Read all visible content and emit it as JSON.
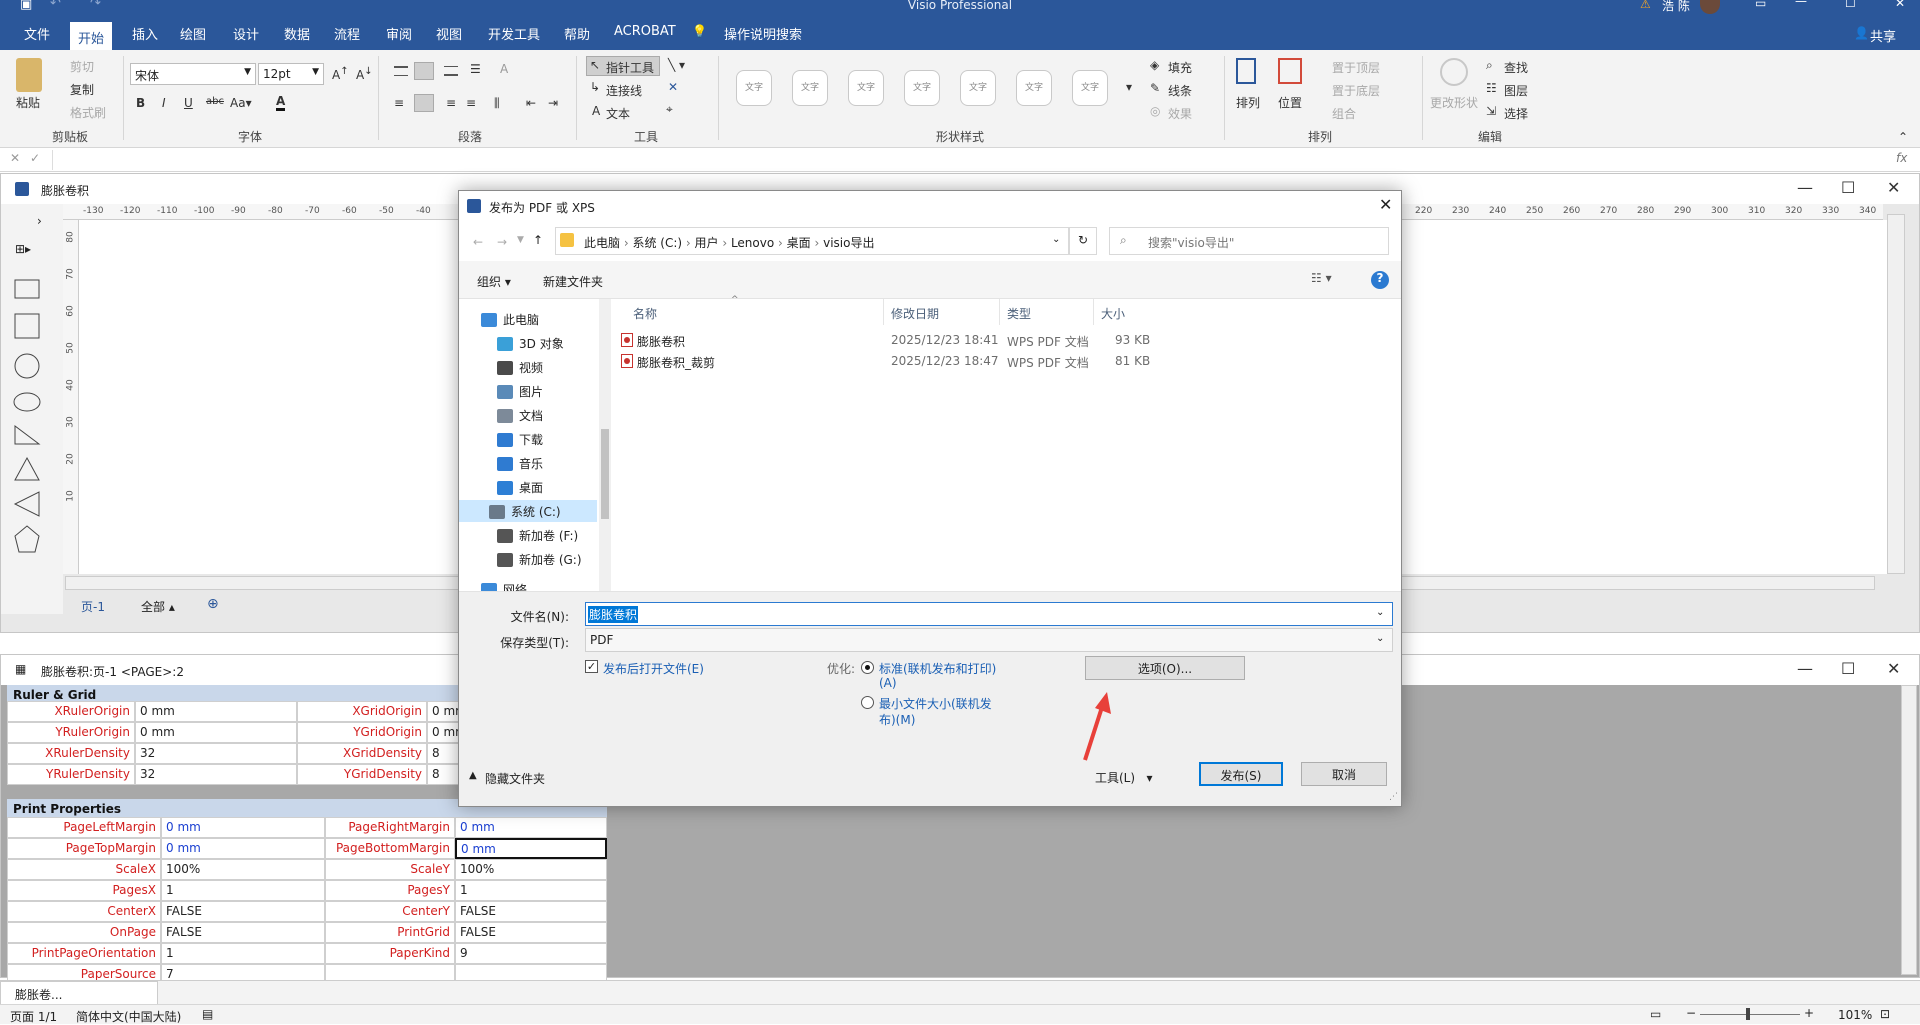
{
  "app": {
    "title": "Visio Professional",
    "user": "浩 陈",
    "share": "共享"
  },
  "menu": [
    "文件",
    "开始",
    "插入",
    "绘图",
    "设计",
    "数据",
    "流程",
    "审阅",
    "视图",
    "开发工具",
    "帮助",
    "ACROBAT",
    "操作说明搜索"
  ],
  "ribbon": {
    "clipboard": {
      "paste": "粘贴",
      "cut": "剪切",
      "copy": "复制",
      "format_painter": "格式刷",
      "label": "剪贴板"
    },
    "font": {
      "name": "宋体",
      "size": "12pt",
      "label": "字体"
    },
    "paragraph": {
      "label": "段落"
    },
    "tools": {
      "pointer": "指针工具",
      "connector": "连接线",
      "text": "文本",
      "label": "工具"
    },
    "shape_styles": {
      "preview_text": "文字",
      "fill": "填充",
      "line": "线条",
      "effects": "效果",
      "label": "形状样式"
    },
    "arrange": {
      "arrange": "排列",
      "position": "位置",
      "bring_front": "置于顶层",
      "send_back": "置于底层",
      "group": "组合",
      "label": "排列"
    },
    "editing": {
      "change_shape": "更改形状",
      "find": "查找",
      "layers": "图层",
      "select": "选择",
      "label": "编辑"
    }
  },
  "drawing_window": {
    "title": "膨胀卷积",
    "ruler_ticks_left": [
      "-130",
      "-120",
      "-110",
      "-100",
      "-90",
      "-80",
      "-70",
      "-60",
      "-50",
      "-40"
    ],
    "ruler_ticks_right": [
      "220",
      "230",
      "240",
      "250",
      "260",
      "270",
      "280",
      "290",
      "300",
      "310",
      "320",
      "330",
      "340"
    ],
    "vruler_ticks": [
      "80",
      "70",
      "60",
      "50",
      "40",
      "30",
      "20",
      "10"
    ],
    "page_tab": "页-1",
    "all_tab": "全部"
  },
  "shapesheet": {
    "title": "膨胀卷积:页-1 <PAGE>:2",
    "ruler_grid_title": "Ruler & Grid",
    "ruler_rows": [
      {
        "l1": "XRulerOrigin",
        "v1": "0 mm",
        "l2": "XGridOrigin",
        "v2": "0 mm"
      },
      {
        "l1": "YRulerOrigin",
        "v1": "0 mm",
        "l2": "YGridOrigin",
        "v2": "0 mm"
      },
      {
        "l1": "XRulerDensity",
        "v1": "32",
        "l2": "XGridDensity",
        "v2": "8"
      },
      {
        "l1": "YRulerDensity",
        "v1": "32",
        "l2": "YGridDensity",
        "v2": "8"
      }
    ],
    "print_title": "Print Properties",
    "print_rows": [
      {
        "l1": "PageLeftMargin",
        "v1": "0 mm",
        "l2": "PageRightMargin",
        "v2": "0 mm"
      },
      {
        "l1": "PageTopMargin",
        "v1": "0 mm",
        "l2": "PageBottomMargin",
        "v2": "0 mm"
      },
      {
        "l1": "ScaleX",
        "v1": "100%",
        "l2": "ScaleY",
        "v2": "100%"
      },
      {
        "l1": "PagesX",
        "v1": "1",
        "l2": "PagesY",
        "v2": "1"
      },
      {
        "l1": "CenterX",
        "v1": "FALSE",
        "l2": "CenterY",
        "v2": "FALSE"
      },
      {
        "l1": "OnPage",
        "v1": "FALSE",
        "l2": "PrintGrid",
        "v2": "FALSE"
      },
      {
        "l1": "PrintPageOrientation",
        "v1": "1",
        "l2": "PaperKind",
        "v2": "9"
      },
      {
        "l1": "PaperSource",
        "v1": "7",
        "l2": "",
        "v2": ""
      }
    ]
  },
  "taskbar_tab": "膨胀卷...",
  "statusbar": {
    "page": "页面 1/1",
    "language": "简体中文(中国大陆)",
    "zoom": "101%"
  },
  "dialog": {
    "title": "发布为 PDF 或 XPS",
    "breadcrumb": [
      "此电脑",
      "系统 (C:)",
      "用户",
      "Lenovo",
      "桌面",
      "visio导出"
    ],
    "search_placeholder": "搜索\"visio导出\"",
    "organize": "组织",
    "new_folder": "新建文件夹",
    "nav_items": [
      {
        "label": "此电脑",
        "indent": 0,
        "color": "#3b8ad9"
      },
      {
        "label": "3D 对象",
        "indent": 1,
        "color": "#3aa0d8"
      },
      {
        "label": "视频",
        "indent": 1,
        "color": "#4a4a4a"
      },
      {
        "label": "图片",
        "indent": 1,
        "color": "#5a8ab8"
      },
      {
        "label": "文档",
        "indent": 1,
        "color": "#7d8a99"
      },
      {
        "label": "下载",
        "indent": 1,
        "color": "#2f7bd1"
      },
      {
        "label": "音乐",
        "indent": 1,
        "color": "#2f7bd1"
      },
      {
        "label": "桌面",
        "indent": 1,
        "color": "#2d7fd5"
      },
      {
        "label": "系统 (C:)",
        "indent": 1,
        "color": "#6a7a8a",
        "selected": true
      },
      {
        "label": "新加卷 (F:)",
        "indent": 1,
        "color": "#555"
      },
      {
        "label": "新加卷 (G:)",
        "indent": 1,
        "color": "#555"
      },
      {
        "label": "网络",
        "indent": 0,
        "color": "#3b8ad9"
      }
    ],
    "columns": [
      "名称",
      "修改日期",
      "类型",
      "大小"
    ],
    "files": [
      {
        "name": "膨胀卷积",
        "date": "2025/12/23 18:41",
        "type": "WPS PDF 文档",
        "size": "93 KB"
      },
      {
        "name": "膨胀卷积_裁剪",
        "date": "2025/12/23 18:47",
        "type": "WPS PDF 文档",
        "size": "81 KB"
      }
    ],
    "filename_label": "文件名(N):",
    "filename_value": "膨胀卷积",
    "filetype_label": "保存类型(T):",
    "filetype_value": "PDF",
    "open_after": "发布后打开文件(E)",
    "optimize_label": "优化:",
    "opt_standard": "标准(联机发布和打印)",
    "opt_standard_key": "(A)",
    "opt_min": "最小文件大小(联机发",
    "opt_min2": "布)(M)",
    "options_button": "选项(O)...",
    "hide_folders": "隐藏文件夹",
    "tools_button": "工具(L)",
    "publish_button": "发布(S)",
    "cancel_button": "取消"
  }
}
